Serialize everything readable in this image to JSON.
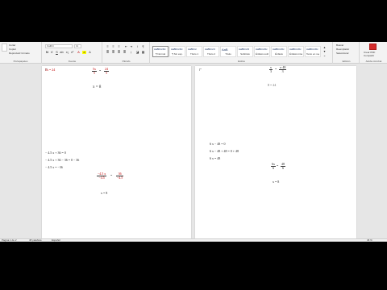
{
  "ribbon": {
    "clipboard": {
      "paste_format": "Reproducir formato",
      "copy": "Copiar",
      "cut": "Cortar",
      "label": "Portapapeles"
    },
    "font": {
      "font_name": "Calibri",
      "font_size": "11",
      "label": "Fuente"
    },
    "paragraph": {
      "label": "Párrafo"
    },
    "styles": {
      "label": "Estilos",
      "tiles": [
        {
          "preview": "AaBbCcDc",
          "name": "¶ Normal",
          "active": true
        },
        {
          "preview": "AaBbCcDc",
          "name": "¶ Sin esp."
        },
        {
          "preview": "AaBbCc",
          "name": "Título 1"
        },
        {
          "preview": "AaBbCcC",
          "name": "Título 2"
        },
        {
          "preview": "AaB",
          "name": "Título"
        },
        {
          "preview": "AaBbCcD",
          "name": "Subtítulo"
        },
        {
          "preview": "AaBbCcDc",
          "name": "Énfasis sutil"
        },
        {
          "preview": "AaBbCcDc",
          "name": "Énfasis"
        },
        {
          "preview": "AaBbCcDc",
          "name": "Énfasis intenso"
        },
        {
          "preview": "AaBbCcDc",
          "name": "Texto en negrita"
        },
        {
          "preview": "AaBbCcDc",
          "name": "Cita"
        },
        {
          "preview": "AaBbCcDc",
          "name": "Cita destacada"
        }
      ]
    },
    "editing": {
      "find": "Buscar",
      "replace": "Reemplazar",
      "select": "Seleccionar",
      "label": "Edición"
    },
    "pdf": {
      "create": "Crear PDF",
      "share": "Compartir",
      "label": "Adobe Acrobat"
    }
  },
  "page_left": {
    "top_line": "5x = 24",
    "top_frac": {
      "num": "5x",
      "den": "5",
      "eq": "=",
      "num2": "24",
      "den2": "5"
    },
    "result1": "x = 8",
    "step1": "− 4.5 x + 36 = 0",
    "step2": "− 4.5 x + 36 − 36 = 0 − 36",
    "step3": "− 4.5 x = −36",
    "frac2": {
      "num": "−4.5 x",
      "den": "−4.5",
      "eq": "=",
      "num2": "36",
      "den2": "−4.5"
    },
    "result2": "x = 8"
  },
  "page_right": {
    "top_frac": {
      "num": "x",
      "den": "3",
      "eq": "=",
      "num2": "x·48",
      "den2": "3"
    },
    "top_result": "8 = 24",
    "step1": "6 x − 48 = 0",
    "step2": "6 x − 48 + 48 = 0 + 48",
    "step3": "6 x = 48",
    "frac": {
      "num": "6x",
      "den": "6",
      "eq": "=",
      "num2": "48",
      "den2": "6"
    },
    "result": "x = 8"
  },
  "status": {
    "page_info": "Página 1 de 2",
    "word_count": "48 palabras",
    "language": "Español",
    "zoom": "46 %"
  },
  "colors": {
    "accent_red": "#c00000",
    "ribbon_bg": "#f3f3f3",
    "workspace_bg": "#e6e6e6"
  }
}
